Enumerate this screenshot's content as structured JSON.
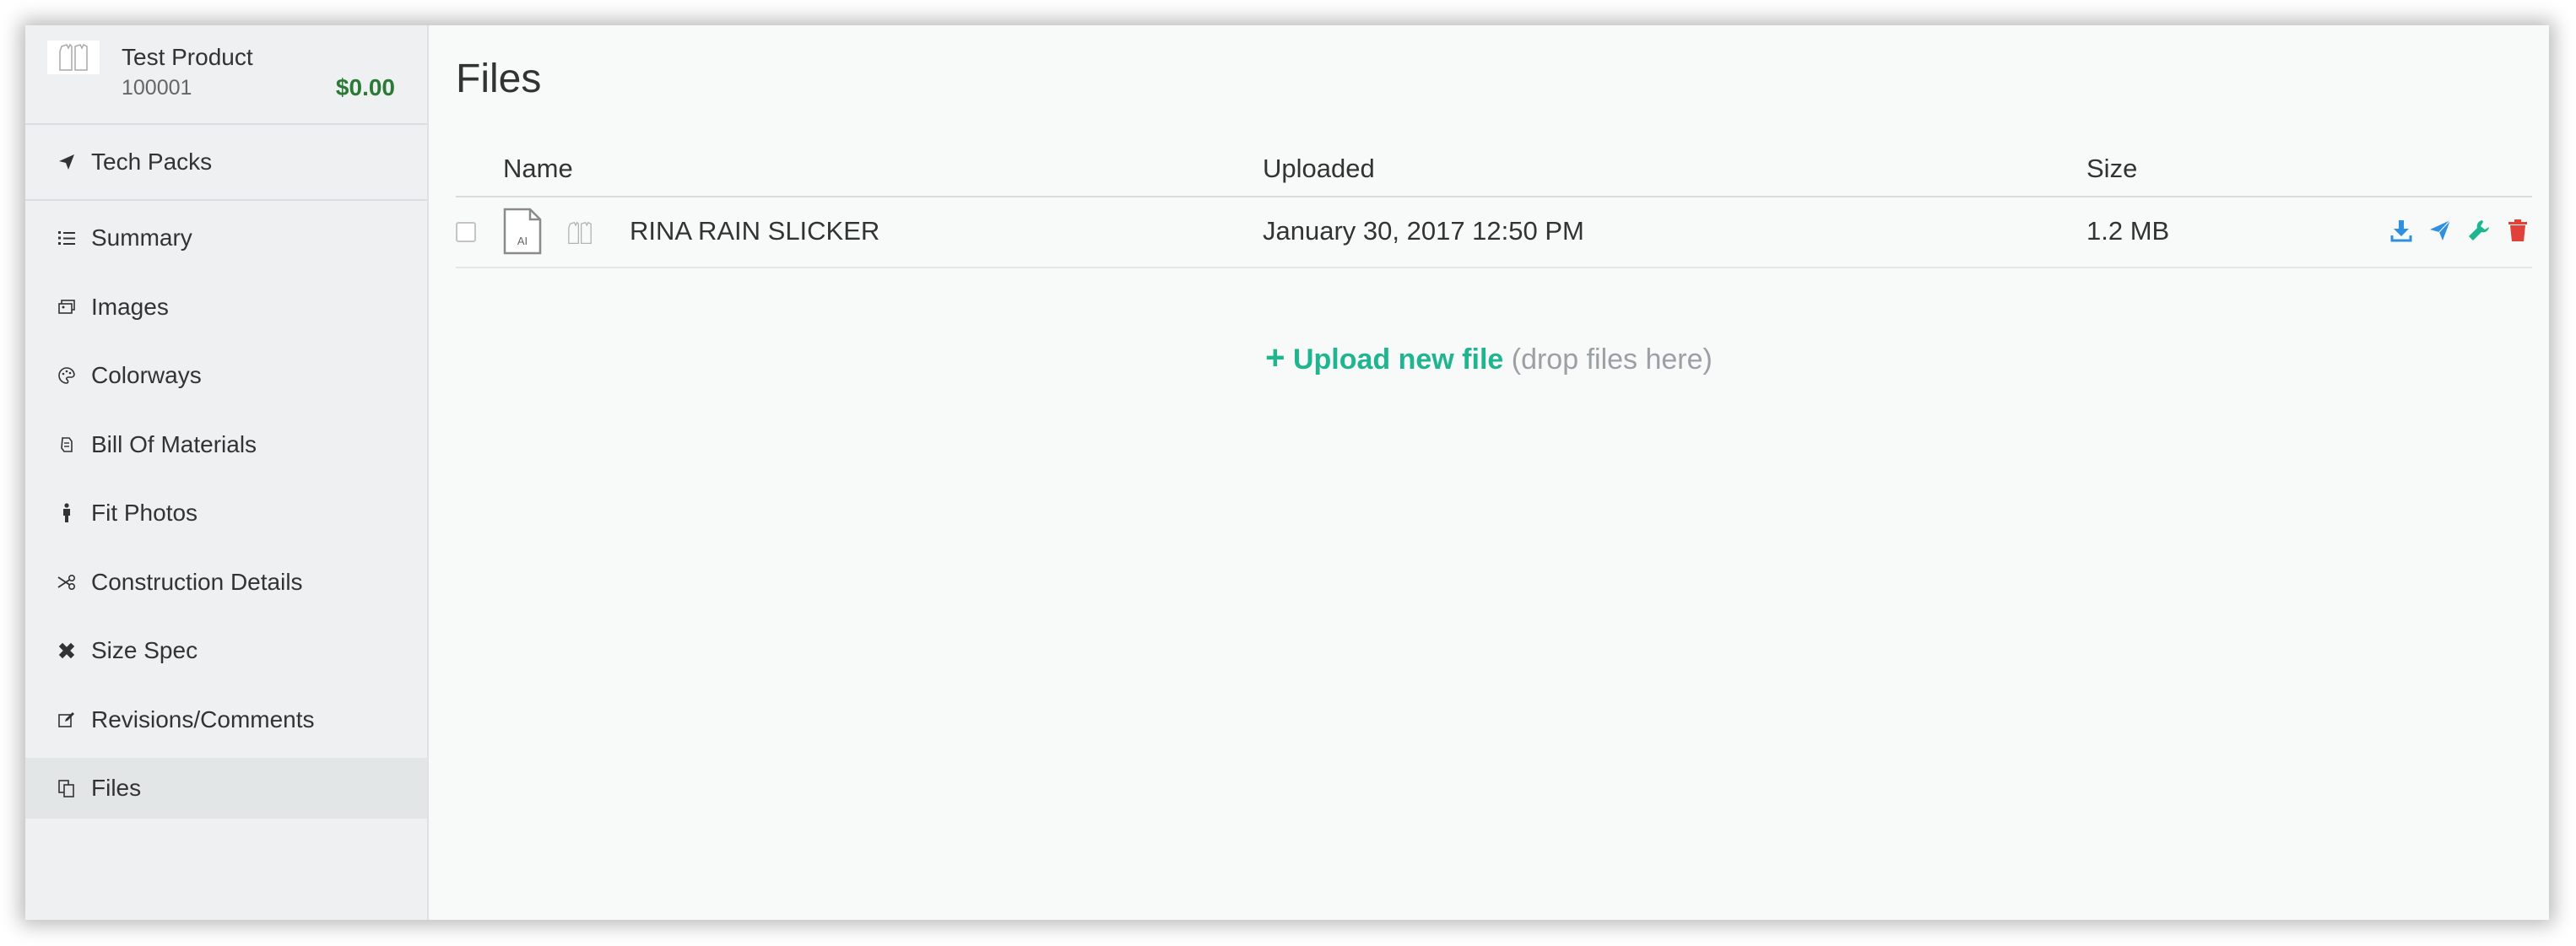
{
  "product": {
    "name": "Test Product",
    "code": "100001",
    "price": "$0.00"
  },
  "techpacks": {
    "icon": "paper-plane-icon",
    "label": "Tech Packs"
  },
  "nav": {
    "items": [
      {
        "icon": "list-icon",
        "label": "Summary"
      },
      {
        "icon": "images-icon",
        "label": "Images"
      },
      {
        "icon": "palette-icon",
        "label": "Colorways"
      },
      {
        "icon": "bill-icon",
        "label": "Bill Of Materials"
      },
      {
        "icon": "person-icon",
        "label": "Fit Photos"
      },
      {
        "icon": "scissors-icon",
        "label": "Construction Details"
      },
      {
        "icon": "ruler-icon",
        "label": "Size Spec"
      },
      {
        "icon": "edit-icon",
        "label": "Revisions/Comments"
      },
      {
        "icon": "files-icon",
        "label": "Files",
        "active": true
      }
    ]
  },
  "main": {
    "title": "Files",
    "columns": [
      "Name",
      "Uploaded",
      "Size"
    ],
    "rows": [
      {
        "filetype": "AI",
        "name": "RINA RAIN SLICKER",
        "uploaded": "January 30, 2017 12:50 PM",
        "size": "1.2 MB",
        "checked": false
      }
    ],
    "actions": [
      {
        "icon": "download-icon",
        "color": "#2f8fe0"
      },
      {
        "icon": "paper-plane-icon",
        "color": "#2f8fe0"
      },
      {
        "icon": "wrench-icon",
        "color": "#1fb58f"
      },
      {
        "icon": "trash-icon",
        "color": "#e0423a"
      }
    ],
    "upload": {
      "plus": "+",
      "link": "Upload new file",
      "hint": "(drop files here)"
    }
  },
  "colors": {
    "accent": "#1fb58f",
    "price": "#2a7a35",
    "action_blue": "#2f8fe0",
    "action_red": "#e0423a"
  }
}
